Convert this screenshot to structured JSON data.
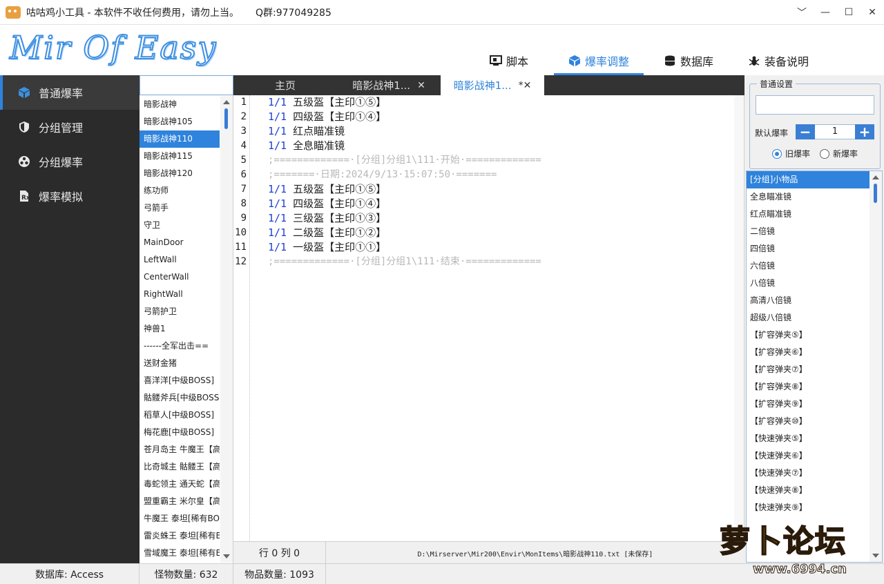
{
  "titlebar": {
    "title": "咕咕鸡小工具 - 本软件不收任何费用，请勿上当。",
    "qq": "Q群:977049285",
    "minimize": "﹀",
    "min": "—",
    "max": "☐",
    "close": "✕"
  },
  "header": {
    "logo": "Mir Of Easy",
    "tabs": [
      {
        "label": "脚本",
        "icon": "monitor-icon"
      },
      {
        "label": "爆率调整",
        "icon": "cube-icon",
        "active": true
      },
      {
        "label": "数据库",
        "icon": "database-icon"
      },
      {
        "label": "装备说明",
        "icon": "bug-icon"
      }
    ]
  },
  "sidebar": {
    "items": [
      {
        "label": "普通爆率",
        "icon": "cube-icon",
        "active": true
      },
      {
        "label": "分组管理",
        "icon": "shield-icon"
      },
      {
        "label": "分组爆率",
        "icon": "group-icon"
      },
      {
        "label": "爆率模拟",
        "icon": "prescription-icon"
      }
    ]
  },
  "monsters": {
    "search_value": "",
    "items": [
      "暗影战神",
      "暗影战神105",
      "暗影战神110",
      "暗影战神115",
      "暗影战神120",
      "练功师",
      "弓箭手",
      "守卫",
      "MainDoor",
      "LeftWall",
      "CenterWall",
      "RightWall",
      "弓箭护卫",
      "神兽1",
      "------全军出击==",
      "送财金猪",
      "喜洋洋[中级BOSS]",
      "骷髅斧兵[中级BOSS]",
      "稻草人[中级BOSS]",
      "梅花鹿[中级BOSS]",
      "苍月岛主 牛魔王【高",
      "比奇城主 骷髅王【高",
      "毒蛇领主 通天蛇【高",
      "盟重霸主 米尔皇【高",
      "牛魔王 泰坦[稀有BO",
      "雷炎蛛王 泰坦[稀有B",
      "雪域魔王 泰坦[稀有B"
    ],
    "selected_index": 2
  },
  "editor": {
    "tabs": [
      {
        "label": "主页",
        "close": ""
      },
      {
        "label": "暗影战神1...",
        "close": "✕"
      },
      {
        "label": "暗影战神1...",
        "close": "*✕",
        "active": true
      }
    ],
    "lines": [
      {
        "n": "1",
        "rate": "1/1",
        "text": " 五级盔【主印①⑤】",
        "comment": false
      },
      {
        "n": "2",
        "rate": "1/1",
        "text": " 四级盔【主印①④】",
        "comment": false
      },
      {
        "n": "3",
        "rate": "1/1",
        "text": " 红点瞄准镜",
        "comment": false
      },
      {
        "n": "4",
        "rate": "1/1",
        "text": " 全息瞄准镜",
        "comment": false
      },
      {
        "n": "5",
        "rate": "",
        "text": ";=============·[分组]分组1\\111·开始·=============",
        "comment": true
      },
      {
        "n": "6",
        "rate": "",
        "text": ";=======·日期:2024/9/13·15:07:50·=======",
        "comment": true
      },
      {
        "n": "7",
        "rate": "1/1",
        "text": " 五级盔【主印①⑤】",
        "comment": false
      },
      {
        "n": "8",
        "rate": "1/1",
        "text": " 四级盔【主印①④】",
        "comment": false
      },
      {
        "n": "9",
        "rate": "1/1",
        "text": " 三级盔【主印①③】",
        "comment": false
      },
      {
        "n": "10",
        "rate": "1/1",
        "text": " 二级盔【主印①②】",
        "comment": false
      },
      {
        "n": "11",
        "rate": "1/1",
        "text": " 一级盔【主印①①】",
        "comment": false
      },
      {
        "n": "12",
        "rate": "",
        "text": ";=============·[分组]分组1\\111·结束·=============",
        "comment": true
      }
    ],
    "status_pos": "行 0 列 0",
    "status_path": "D:\\Mirserver\\Mir200\\Envir\\MonItems\\暗影战神110.txt [未保存]"
  },
  "settings": {
    "legend": "普通设置",
    "input_value": "",
    "default_rate_label": "默认爆率",
    "minus": "−",
    "plus": "+",
    "default_rate_value": "1",
    "radio_old": "旧爆率",
    "radio_new": "新爆率"
  },
  "items": {
    "list": [
      "[分组]小物品",
      "全息瞄准镜",
      "红点瞄准镜",
      "二倍镜",
      "四倍镜",
      "六倍镜",
      "八倍镜",
      "高清八倍镜",
      "超级八倍镜",
      "【扩容弹夹⑤】",
      "【扩容弹夹⑥】",
      "【扩容弹夹⑦】",
      "【扩容弹夹⑧】",
      "【扩容弹夹⑨】",
      "【扩容弹夹⑩】",
      "【快速弹夹⑤】",
      "【快速弹夹⑥】",
      "【快速弹夹⑦】",
      "【快速弹夹⑧】",
      "【快速弹夹⑨】"
    ],
    "selected_index": 0
  },
  "statusbar": {
    "db": "数据库: Access",
    "monster_count": "怪物数量: 632",
    "item_count": "物品数量: 1093"
  },
  "watermark": {
    "text": "萝卜论坛",
    "url": "www.6994.cn"
  },
  "colors": {
    "accent": "#2f83dc",
    "sidebar_bg": "#2b2b2b",
    "tab_bar_bg": "#333333",
    "rate_blue": "#1c3fd1",
    "comment_gray": "#b8b8b8"
  }
}
